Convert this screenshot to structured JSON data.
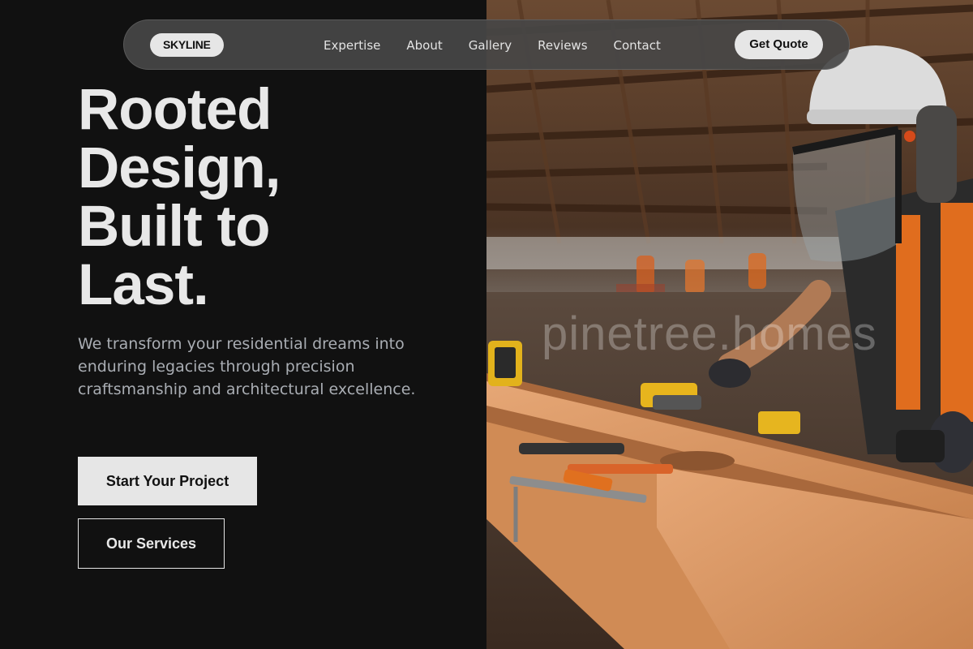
{
  "nav": {
    "logo": "SKYLINE",
    "links": [
      "Expertise",
      "About",
      "Gallery",
      "Reviews",
      "Contact"
    ],
    "cta": "Get Quote"
  },
  "hero": {
    "headline_lines": [
      "Rooted",
      "Design,",
      "Built to",
      "Last."
    ],
    "subtext": "We transform your residential dreams into enduring legacies through precision craftsmanship and architectural excellence.",
    "primary_button": "Start Your Project",
    "secondary_button": "Our Services"
  },
  "image": {
    "watermark": "pinetree.homes"
  },
  "colors": {
    "background": "#111111",
    "button": "#e6e6e6",
    "nav_bg": "#464646",
    "safety_orange": "#e0661c",
    "lumber": "#d99a63"
  }
}
